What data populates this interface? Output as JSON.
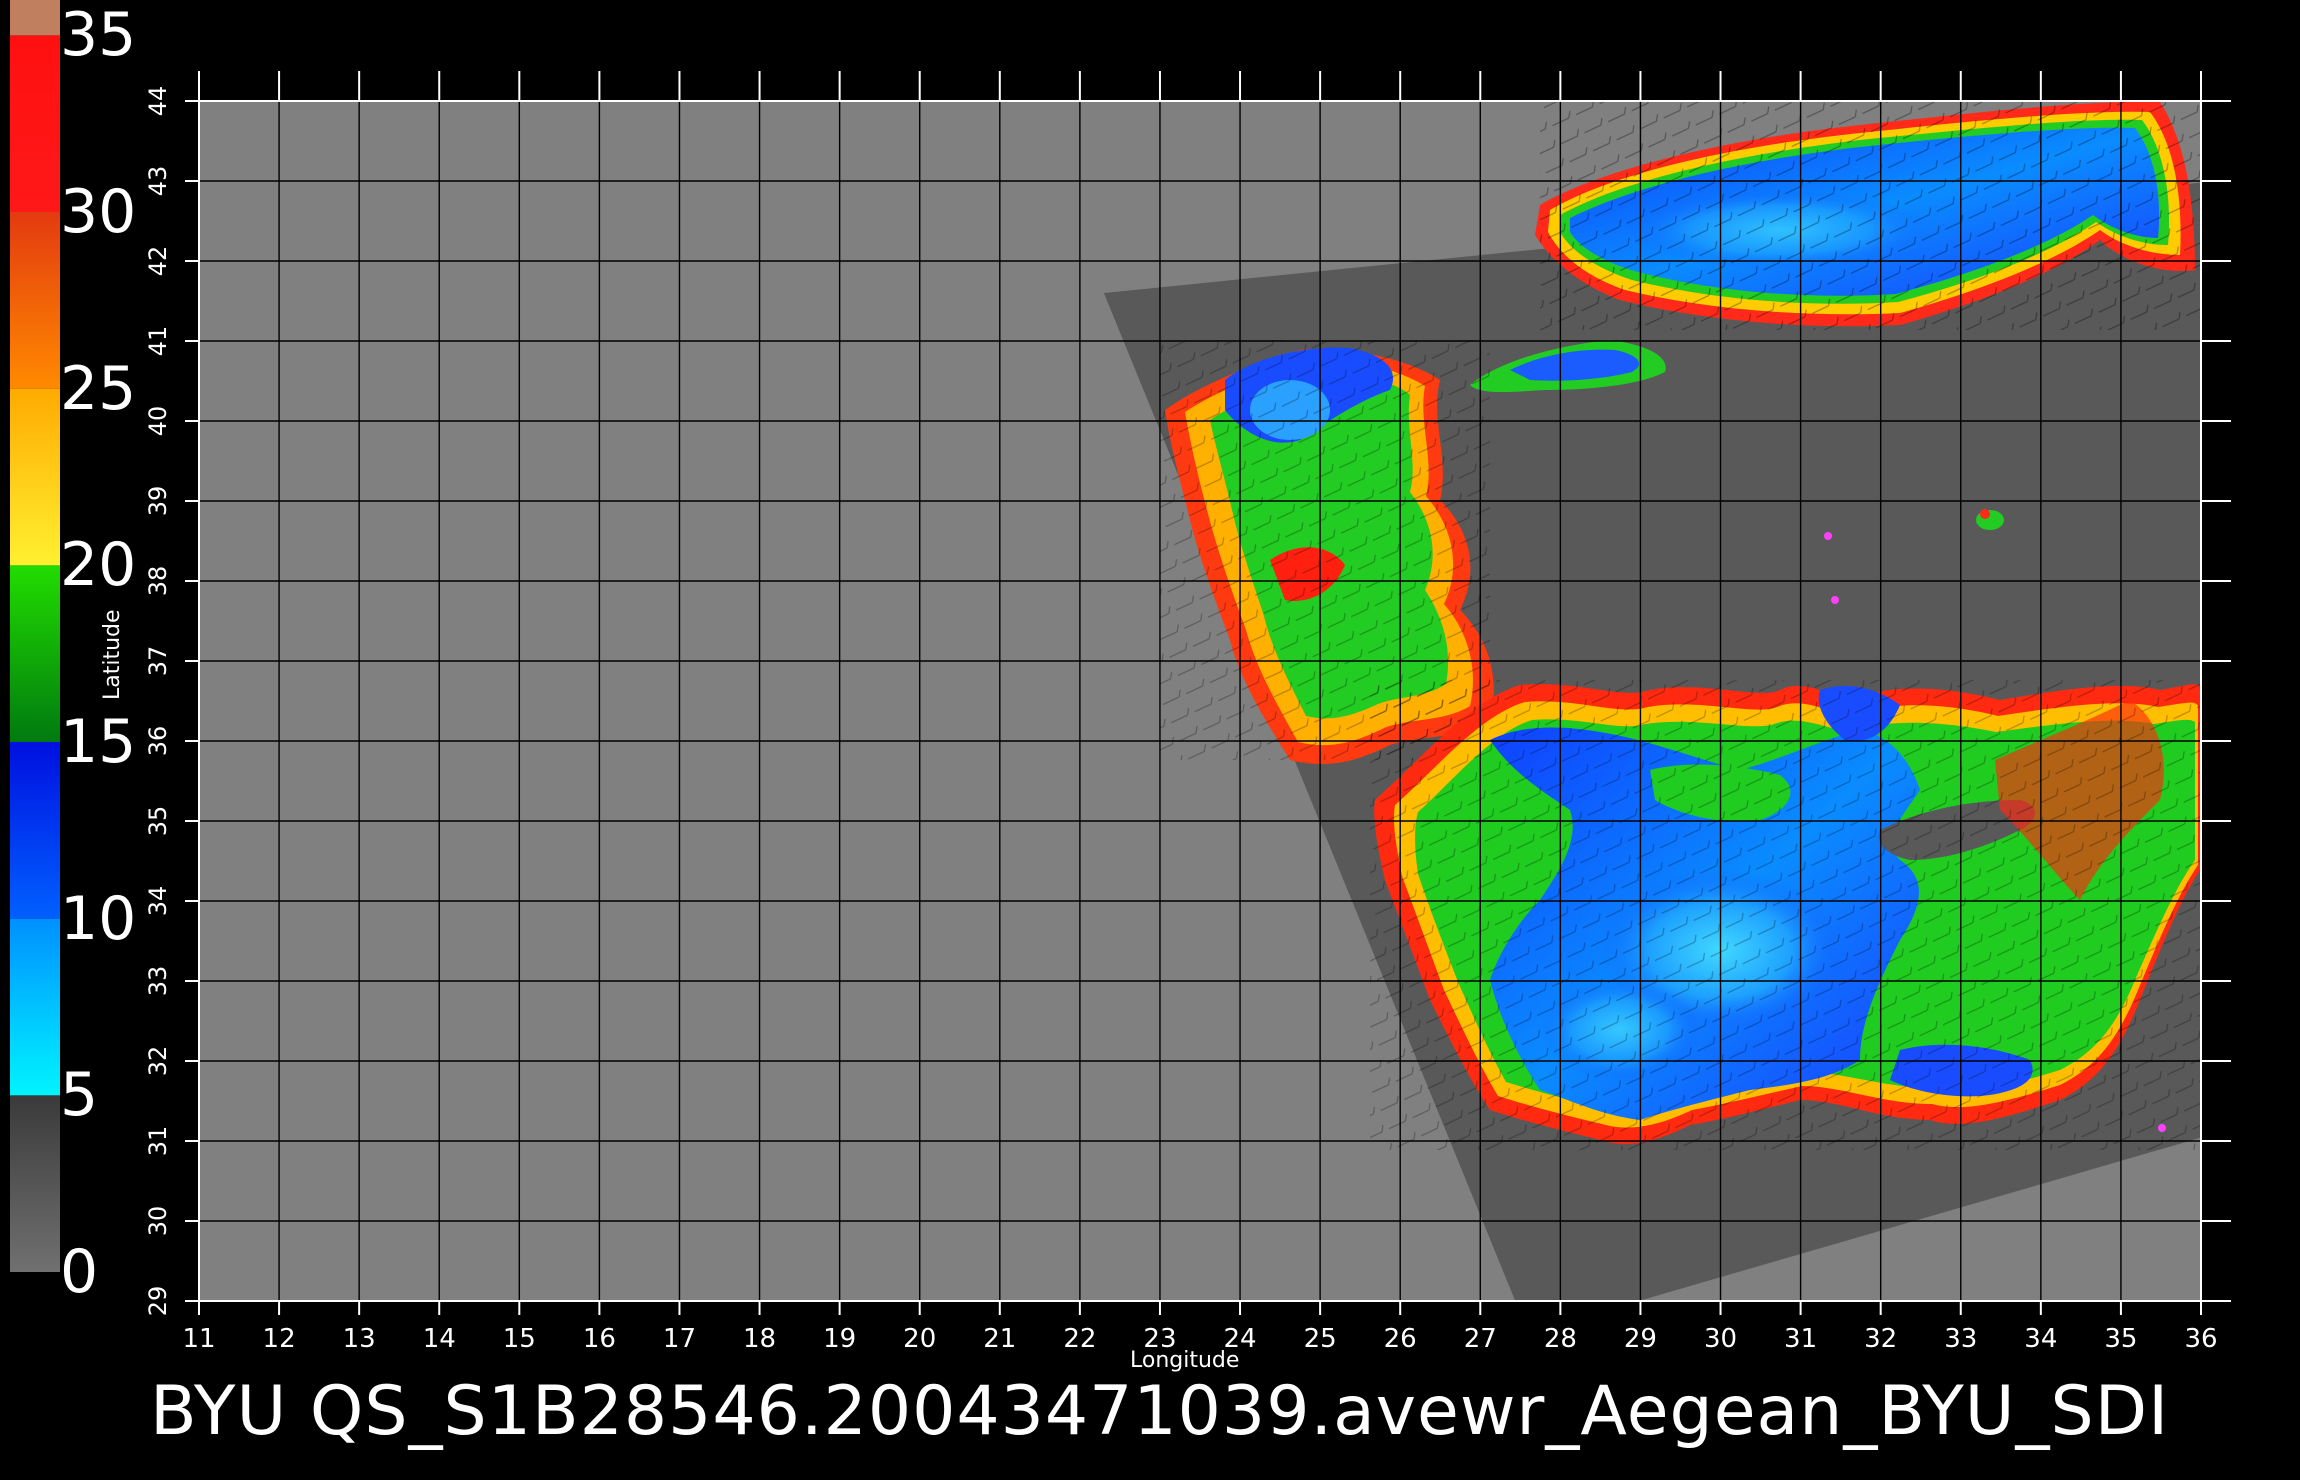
{
  "colorbar": {
    "labels": [
      "35",
      "30",
      "25",
      "20",
      "15",
      "10",
      "5",
      "0"
    ],
    "bands": [
      {
        "from": 0,
        "to": 5,
        "colors": [
          "#707070",
          "#3a3a3a"
        ]
      },
      {
        "from": 5,
        "to": 10,
        "colors": [
          "#00f4ff",
          "#0090ff"
        ]
      },
      {
        "from": 10,
        "to": 15,
        "colors": [
          "#0060ff",
          "#0010e0"
        ]
      },
      {
        "from": 15,
        "to": 20,
        "colors": [
          "#007a10",
          "#22dd00"
        ]
      },
      {
        "from": 20,
        "to": 25,
        "colors": [
          "#fff030",
          "#ffaa00"
        ]
      },
      {
        "from": 25,
        "to": 30,
        "colors": [
          "#ff8a00",
          "#e33a10"
        ]
      },
      {
        "from": 30,
        "to": 35,
        "colors": [
          "#ff1818",
          "#ff1010"
        ]
      },
      {
        "from": 35,
        "to": 36,
        "colors": [
          "#c08060",
          "#c08060"
        ]
      }
    ]
  },
  "map": {
    "lon_ticks": [
      "11",
      "12",
      "13",
      "14",
      "15",
      "16",
      "17",
      "18",
      "19",
      "20",
      "21",
      "22",
      "23",
      "24",
      "25",
      "26",
      "27",
      "28",
      "29",
      "30",
      "31",
      "32",
      "33",
      "34",
      "35",
      "36"
    ],
    "lat_ticks": [
      "29",
      "30",
      "31",
      "32",
      "33",
      "34",
      "35",
      "36",
      "37",
      "38",
      "39",
      "40",
      "41",
      "42",
      "43",
      "44"
    ],
    "x_title": "Longitude",
    "y_title": "Latitude",
    "lon_range": [
      11,
      36
    ],
    "lat_range": [
      29,
      44
    ],
    "swath_polygon_lonlat": [
      [
        22.3,
        41.6
      ],
      [
        36.2,
        43.0
      ],
      [
        36.2,
        31.1
      ],
      [
        27.6,
        28.6
      ]
    ],
    "colors": {
      "no_data": "#808080",
      "swath": "#595959",
      "grid": "#000000",
      "frame": "#ffffff"
    }
  },
  "caption": "BYU  QS_S1B28546.20043471039.avewr_Aegean_BYU_SDI"
}
